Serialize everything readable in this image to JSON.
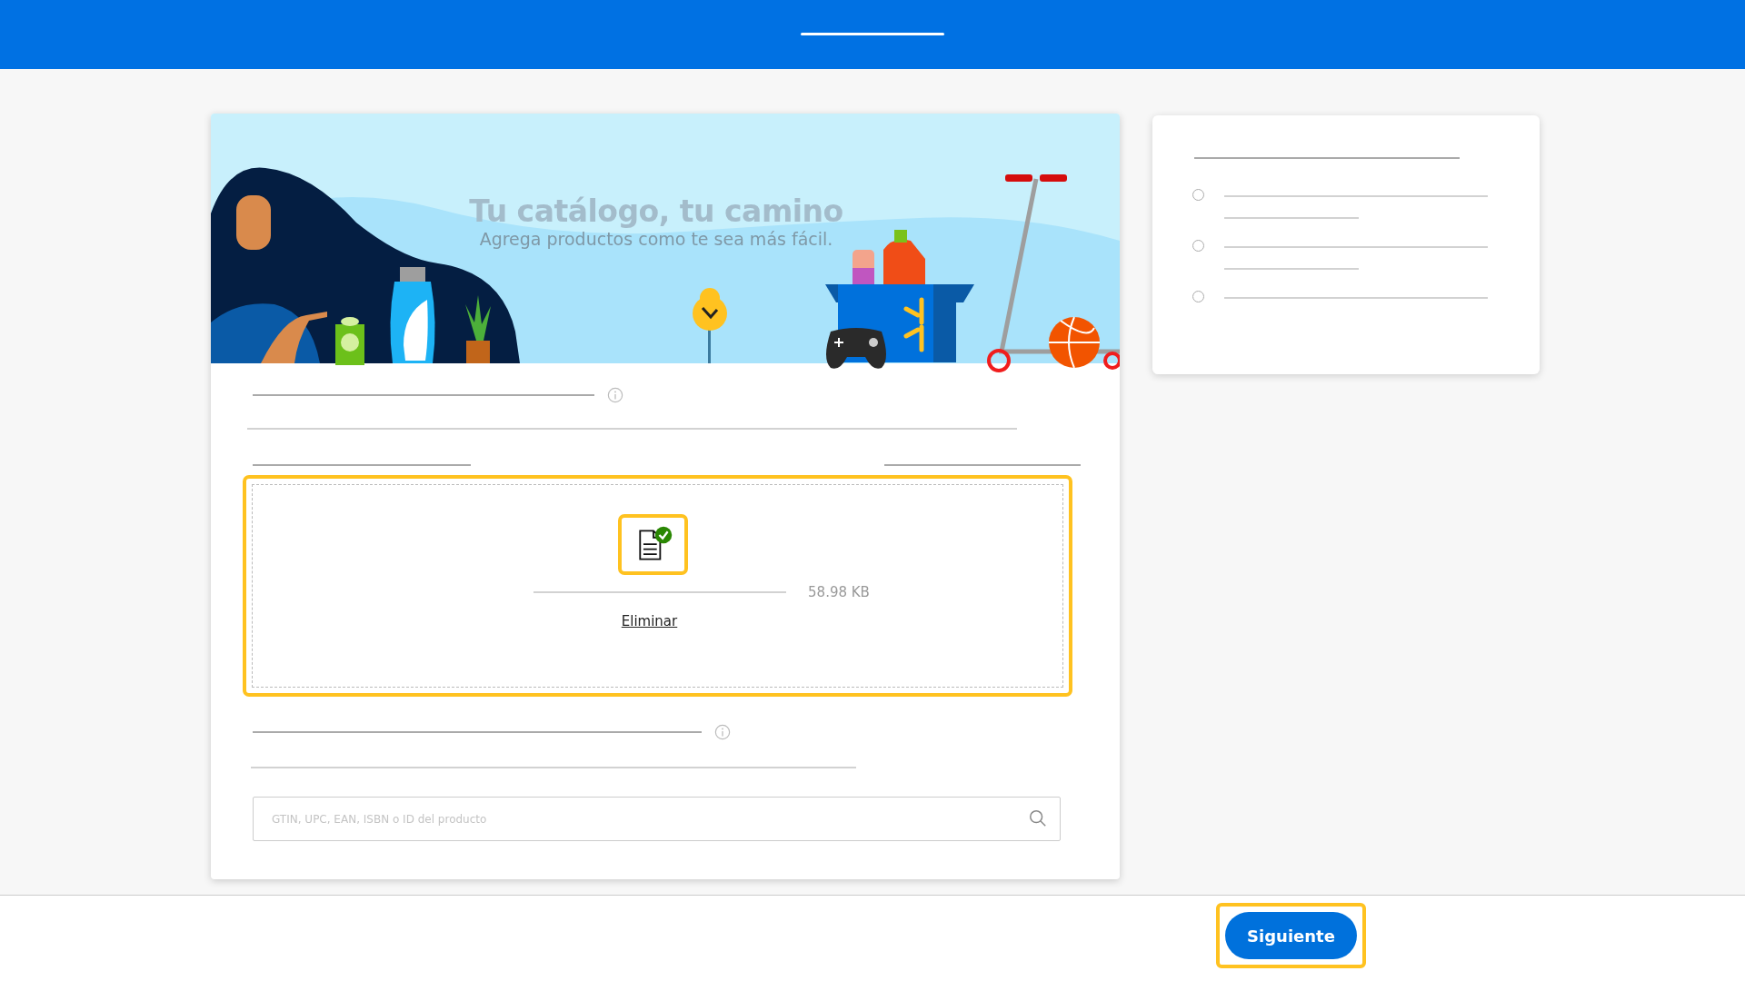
{
  "banner": {
    "title": "Tu catálogo, tu camino",
    "subtitle": "Agrega productos como te sea más fácil."
  },
  "upload": {
    "highlighted": true,
    "file_size": "58.98 KB",
    "remove_link": "Eliminar"
  },
  "search": {
    "placeholder": "GTIN, UPC, EAN, ISBN o ID del producto"
  },
  "options": [
    {
      "kind": "two_line",
      "selected": false
    },
    {
      "kind": "two_line",
      "selected": false
    },
    {
      "kind": "one_line",
      "selected": false
    }
  ],
  "footer": {
    "next_button": "Siguiente",
    "highlighted": true
  }
}
